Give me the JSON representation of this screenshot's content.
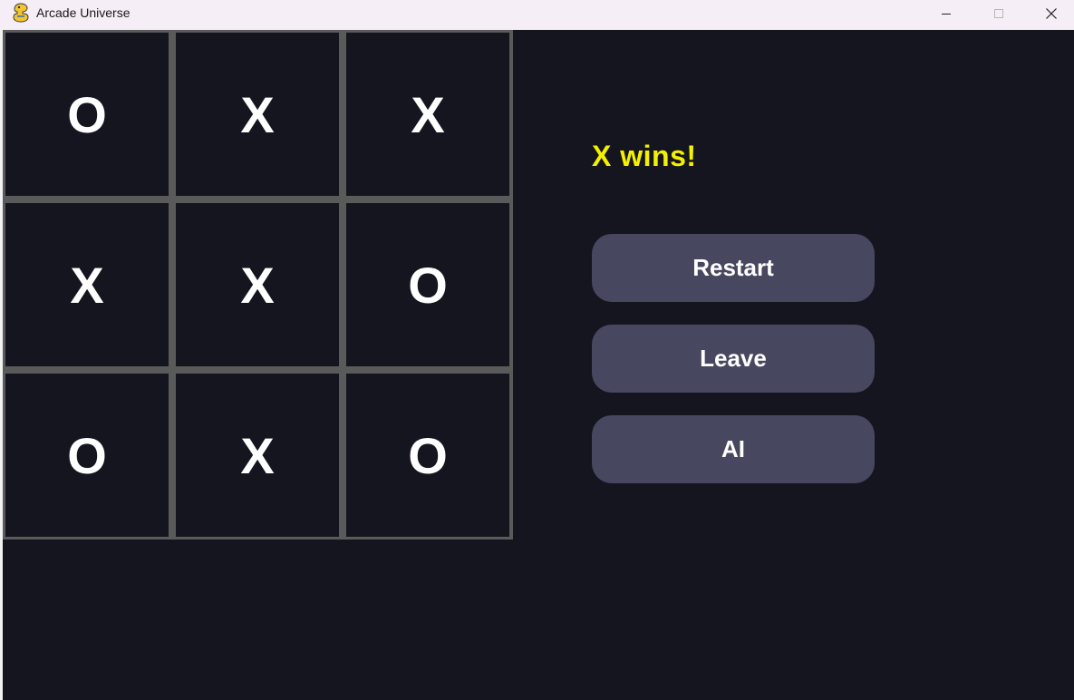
{
  "window": {
    "title": "Arcade Universe",
    "app_icon": "pygame-snake-icon",
    "controls": [
      "minimize-icon",
      "maximize-icon",
      "close-icon"
    ]
  },
  "colors": {
    "background": "#15151f",
    "grid_lines": "#5a5a5a",
    "marks": "#ffffff",
    "status": "#f4f000",
    "button_bg": "#484760",
    "button_text": "#ffffff"
  },
  "board": {
    "cells": [
      "O",
      "X",
      "X",
      "X",
      "X",
      "O",
      "O",
      "X",
      "O"
    ]
  },
  "status": {
    "text": "X wins!"
  },
  "buttons": {
    "restart": "Restart",
    "leave": "Leave",
    "ai": "AI"
  }
}
